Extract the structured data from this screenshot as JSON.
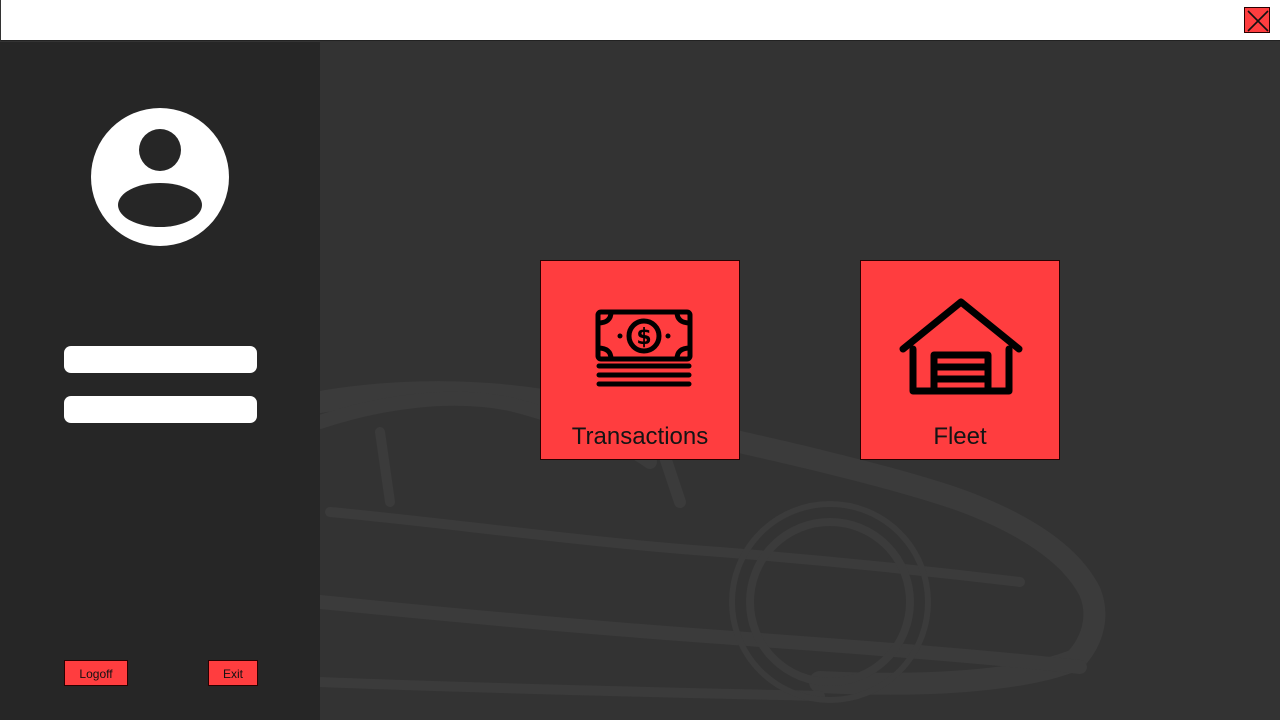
{
  "window": {
    "close_icon": "close-x-icon"
  },
  "sidebar": {
    "avatar_icon": "user-avatar-icon",
    "fields": [
      {
        "value": ""
      },
      {
        "value": ""
      }
    ],
    "logoff_label": "Logoff",
    "exit_label": "Exit"
  },
  "main": {
    "background_icon": "car-silhouette",
    "tiles": [
      {
        "label": "Transactions",
        "icon": "money-icon"
      },
      {
        "label": "Fleet",
        "icon": "garage-icon"
      }
    ]
  },
  "colors": {
    "accent": "#ff3d3f",
    "sidebar_bg": "#262626",
    "main_bg": "#333333",
    "titlebar_bg": "#ffffff"
  }
}
